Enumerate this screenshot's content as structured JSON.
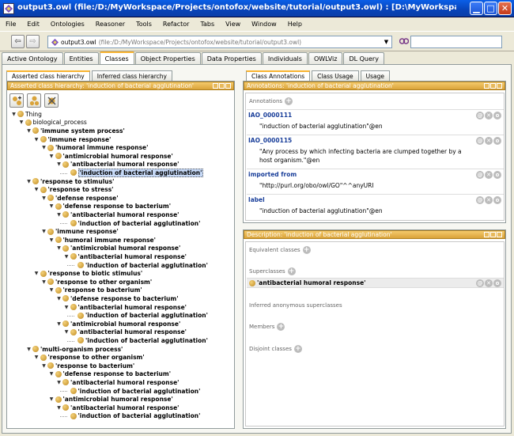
{
  "window": {
    "title": "output3.owl (file:/D:/MyWorkspace/Projects/ontofox/website/tutorial/output3.owl) : [D:\\MyWorkspace\\Projects\\ontofox\\website\\tu..."
  },
  "menu": [
    "File",
    "Edit",
    "Ontologies",
    "Reasoner",
    "Tools",
    "Refactor",
    "Tabs",
    "View",
    "Window",
    "Help"
  ],
  "toolbar": {
    "ontology_name": "output3.owl",
    "ontology_path": "(file:/D:/MyWorkspace/Projects/ontofox/website/tutorial/output3.owl)",
    "search_value": ""
  },
  "main_tabs": [
    "Active Ontology",
    "Entities",
    "Classes",
    "Object Properties",
    "Data Properties",
    "Individuals",
    "OWLViz",
    "DL Query"
  ],
  "left": {
    "tabs": [
      "Asserted class hierarchy",
      "Inferred class hierarchy"
    ],
    "header": "Asserted class hierarchy: 'induction of bacterial agglutination'",
    "tree": [
      {
        "label": "Thing",
        "depth": 0,
        "bold": false
      },
      {
        "label": "biological_process",
        "depth": 1,
        "bold": false
      },
      {
        "label": "'immune system process'",
        "depth": 2,
        "bold": true
      },
      {
        "label": "'immune response'",
        "depth": 3,
        "bold": true
      },
      {
        "label": "'humoral immune response'",
        "depth": 4,
        "bold": true
      },
      {
        "label": "'antimicrobial humoral response'",
        "depth": 5,
        "bold": true
      },
      {
        "label": "'antibacterial humoral response'",
        "depth": 6,
        "bold": true
      },
      {
        "label": "'induction of bacterial agglutination'",
        "depth": 7,
        "bold": true,
        "selected": true
      },
      {
        "label": "'response to stimulus'",
        "depth": 2,
        "bold": true
      },
      {
        "label": "'response to stress'",
        "depth": 3,
        "bold": true
      },
      {
        "label": "'defense response'",
        "depth": 4,
        "bold": true
      },
      {
        "label": "'defense response to bacterium'",
        "depth": 5,
        "bold": true
      },
      {
        "label": "'antibacterial humoral response'",
        "depth": 6,
        "bold": true
      },
      {
        "label": "'induction of bacterial agglutination'",
        "depth": 7,
        "bold": true
      },
      {
        "label": "'immune response'",
        "depth": 4,
        "bold": true
      },
      {
        "label": "'humoral immune response'",
        "depth": 5,
        "bold": true
      },
      {
        "label": "'antimicrobial humoral response'",
        "depth": 6,
        "bold": true
      },
      {
        "label": "'antibacterial humoral response'",
        "depth": 7,
        "bold": true
      },
      {
        "label": "'induction of bacterial agglutination'",
        "depth": 8,
        "bold": true
      },
      {
        "label": "'response to biotic stimulus'",
        "depth": 3,
        "bold": true
      },
      {
        "label": "'response to other organism'",
        "depth": 4,
        "bold": true
      },
      {
        "label": "'response to bacterium'",
        "depth": 5,
        "bold": true
      },
      {
        "label": "'defense response to bacterium'",
        "depth": 6,
        "bold": true
      },
      {
        "label": "'antibacterial humoral response'",
        "depth": 7,
        "bold": true
      },
      {
        "label": "'induction of bacterial agglutination'",
        "depth": 8,
        "bold": true
      },
      {
        "label": "'antimicrobial humoral response'",
        "depth": 6,
        "bold": true
      },
      {
        "label": "'antibacterial humoral response'",
        "depth": 7,
        "bold": true
      },
      {
        "label": "'induction of bacterial agglutination'",
        "depth": 8,
        "bold": true
      },
      {
        "label": "'multi-organism process'",
        "depth": 2,
        "bold": true
      },
      {
        "label": "'response to other organism'",
        "depth": 3,
        "bold": true
      },
      {
        "label": "'response to bacterium'",
        "depth": 4,
        "bold": true
      },
      {
        "label": "'defense response to bacterium'",
        "depth": 5,
        "bold": true
      },
      {
        "label": "'antibacterial humoral response'",
        "depth": 6,
        "bold": true
      },
      {
        "label": "'induction of bacterial agglutination'",
        "depth": 7,
        "bold": true
      },
      {
        "label": "'antimicrobial humoral response'",
        "depth": 5,
        "bold": true
      },
      {
        "label": "'antibacterial humoral response'",
        "depth": 6,
        "bold": true
      },
      {
        "label": "'induction of bacterial agglutination'",
        "depth": 7,
        "bold": true
      }
    ]
  },
  "right": {
    "tabs": [
      "Class Annotations",
      "Class Usage",
      "Usage"
    ],
    "annotations_header": "Annotations: 'induction of bacterial agglutination'",
    "annotations_label": "Annotations",
    "annotations": [
      {
        "prop": "IAO_0000111",
        "value": "\"induction of bacterial agglutination\"@en"
      },
      {
        "prop": "IAO_0000115",
        "value": "\"Any process by which infecting bacteria are clumped together by a host organism.\"@en"
      },
      {
        "prop": "imported from",
        "value": "\"http://purl.org/obo/owl/GO\"^^anyURI"
      },
      {
        "prop": "label",
        "value": "\"induction of bacterial agglutination\"@en"
      }
    ],
    "description_header": "Description: 'induction of bacterial agglutination'",
    "description": {
      "equivalent_label": "Equivalent classes",
      "superclasses_label": "Superclasses",
      "superclass_value": "'antibacterial humoral response'",
      "inferred_label": "Inferred anonymous superclasses",
      "members_label": "Members",
      "disjoint_label": "Disjoint classes"
    }
  }
}
